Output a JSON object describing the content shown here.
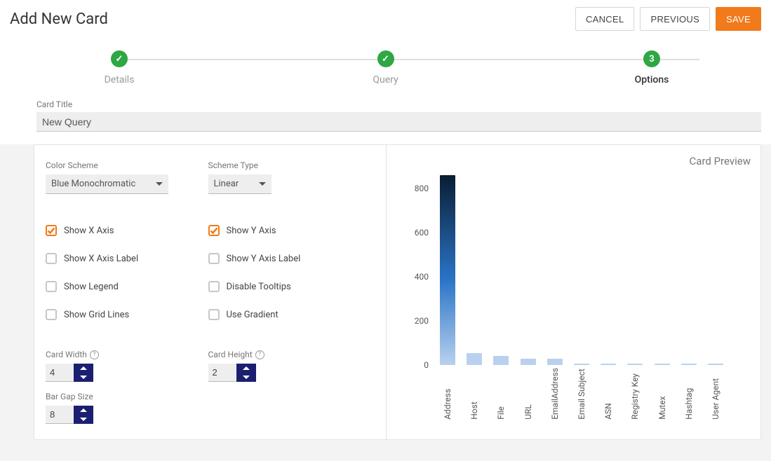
{
  "header": {
    "title": "Add New Card",
    "cancel": "CANCEL",
    "previous": "PREVIOUS",
    "save": "SAVE"
  },
  "stepper": {
    "steps": [
      {
        "label": "Details",
        "badge": "✓"
      },
      {
        "label": "Query",
        "badge": "✓"
      },
      {
        "label": "Options",
        "badge": "3"
      }
    ]
  },
  "card_title": {
    "label": "Card Title",
    "value": "New Query"
  },
  "options": {
    "color_scheme": {
      "label": "Color Scheme",
      "value": "Blue Monochromatic"
    },
    "scheme_type": {
      "label": "Scheme Type",
      "value": "Linear"
    },
    "checkboxes": {
      "show_x_axis": {
        "label": "Show X Axis",
        "checked": true
      },
      "show_y_axis": {
        "label": "Show Y Axis",
        "checked": true
      },
      "show_x_axis_label": {
        "label": "Show X Axis Label",
        "checked": false
      },
      "show_y_axis_label": {
        "label": "Show Y Axis Label",
        "checked": false
      },
      "show_legend": {
        "label": "Show Legend",
        "checked": false
      },
      "disable_tooltips": {
        "label": "Disable Tooltips",
        "checked": false
      },
      "show_grid_lines": {
        "label": "Show Grid Lines",
        "checked": false
      },
      "use_gradient": {
        "label": "Use Gradient",
        "checked": false
      }
    },
    "card_width": {
      "label": "Card Width",
      "value": "4"
    },
    "card_height": {
      "label": "Card Height",
      "value": "2"
    },
    "bar_gap": {
      "label": "Bar Gap Size",
      "value": "8"
    }
  },
  "preview": {
    "title": "Card Preview"
  },
  "chart_data": {
    "type": "bar",
    "categories": [
      "Address",
      "Host",
      "File",
      "URL",
      "EmailAddress",
      "Email Subject",
      "ASN",
      "Registry Key",
      "Mutex",
      "Hashtag",
      "User Agent"
    ],
    "values": [
      860,
      55,
      40,
      30,
      28,
      5,
      5,
      5,
      5,
      5,
      5
    ],
    "y_ticks": [
      0,
      200,
      400,
      600,
      800
    ],
    "ylim": [
      0,
      900
    ],
    "title": "",
    "xlabel": "",
    "ylabel": ""
  }
}
